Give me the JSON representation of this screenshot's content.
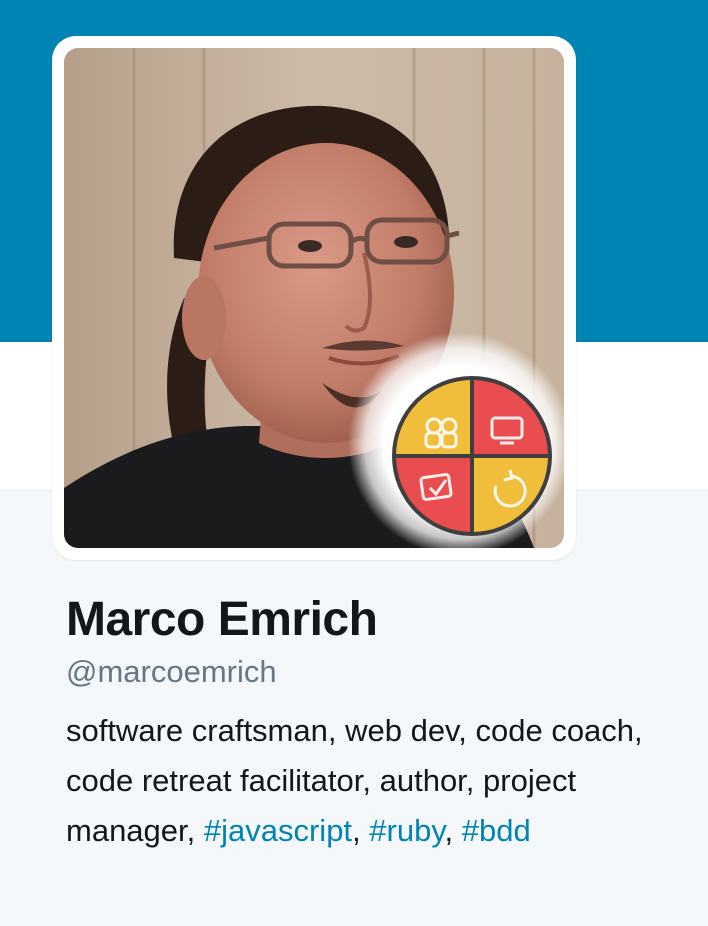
{
  "colors": {
    "banner": "#0084b4",
    "link": "#0084b4",
    "text": "#14171a",
    "muted": "#657786",
    "page_background": "#f5f8fa"
  },
  "profile": {
    "name": "Marco Emrich",
    "handle": "@marcoemrich",
    "bio": {
      "text": "software craftsman, web dev, code coach, code retreat facilitator, author, project manager, ",
      "hashtags": [
        "#javascript",
        "#ruby",
        "#bdd"
      ],
      "separator": ", "
    },
    "avatar_badge_icon": "code-retreat-quadrant-badge"
  }
}
